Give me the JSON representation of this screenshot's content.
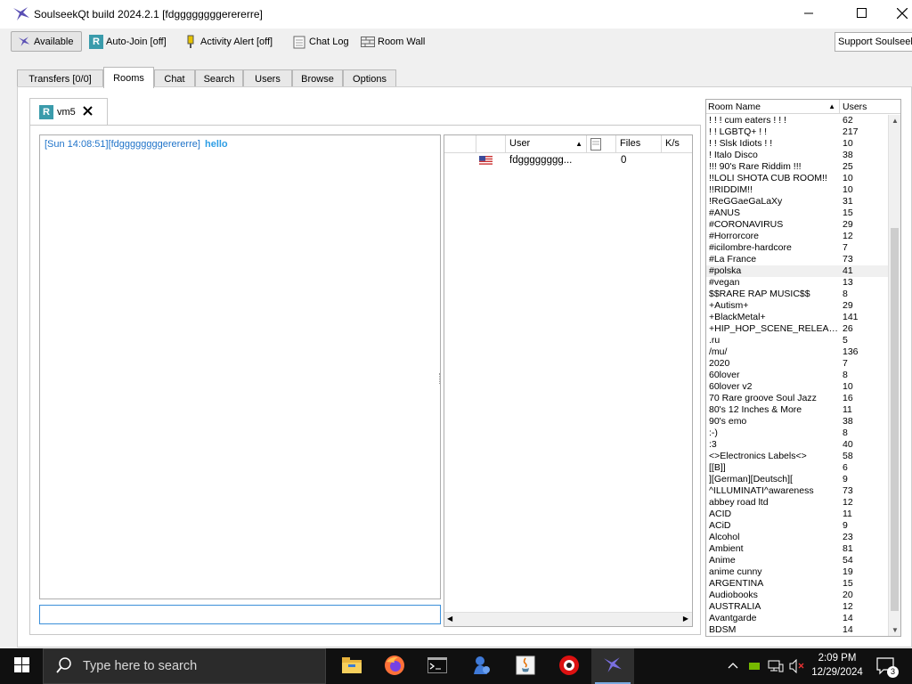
{
  "window": {
    "title": "SoulseekQt build 2024.2.1 [fdggggggggerererre]",
    "minimize_icon": "minimize-icon",
    "maximize_icon": "maximize-icon",
    "close_icon": "close-icon"
  },
  "toolbar": {
    "available": "Available",
    "auto_join": "Auto-Join [off]",
    "activity_alert": "Activity Alert [off]",
    "chat_log": "Chat Log",
    "room_wall": "Room Wall",
    "support": "Support Soulseek"
  },
  "tabs": [
    {
      "label": "Transfers [0/0]"
    },
    {
      "label": "Rooms"
    },
    {
      "label": "Chat"
    },
    {
      "label": "Search"
    },
    {
      "label": "Users"
    },
    {
      "label": "Browse"
    },
    {
      "label": "Options"
    }
  ],
  "room_tab": {
    "badge": "R",
    "name": "vm5"
  },
  "chat": {
    "timestamp": "[Sun 14:08:51]",
    "user": "[fdggggggggerererre]",
    "message": "hello"
  },
  "userlist": {
    "headers": {
      "user": "User",
      "files": "Files",
      "speed": "K/s"
    },
    "rows": [
      {
        "user": "fdgggggggg...",
        "files": "0",
        "flag": "us-flag"
      }
    ]
  },
  "rooms": {
    "headers": {
      "name": "Room Name",
      "users": "Users"
    },
    "selected_index": 13,
    "items": [
      {
        "name": "! ! ! cum eaters ! ! !",
        "users": "62"
      },
      {
        "name": "! ! LGBTQ+ ! !",
        "users": "217"
      },
      {
        "name": "! ! Slsk Idiots ! !",
        "users": "10"
      },
      {
        "name": "! Italo Disco",
        "users": "38"
      },
      {
        "name": "!!! 90's Rare Riddim !!!",
        "users": "25"
      },
      {
        "name": "!!LOLI SHOTA CUB ROOM!!",
        "users": "10"
      },
      {
        "name": "!!RIDDIM!!",
        "users": "10"
      },
      {
        "name": "!ReGGaeGaLaXy",
        "users": "31"
      },
      {
        "name": "#ANUS",
        "users": "15"
      },
      {
        "name": "#CORONAVIRUS",
        "users": "29"
      },
      {
        "name": "#Horrorcore",
        "users": "12"
      },
      {
        "name": "#icilombre-hardcore",
        "users": "7"
      },
      {
        "name": "#La France",
        "users": "73"
      },
      {
        "name": "#polska",
        "users": "41"
      },
      {
        "name": "#vegan",
        "users": "13"
      },
      {
        "name": "$$RARE RAP MUSIC$$",
        "users": "8"
      },
      {
        "name": "+Autism+",
        "users": "29"
      },
      {
        "name": "+BlackMetal+",
        "users": "141"
      },
      {
        "name": "+HIP_HOP_SCENE_RELEASES+",
        "users": "26"
      },
      {
        "name": ".ru",
        "users": "5"
      },
      {
        "name": "/mu/",
        "users": "136"
      },
      {
        "name": "2020",
        "users": "7"
      },
      {
        "name": "60lover",
        "users": "8"
      },
      {
        "name": "60lover v2",
        "users": "10"
      },
      {
        "name": "70 Rare groove Soul Jazz",
        "users": "16"
      },
      {
        "name": "80's 12 Inches & More",
        "users": "11"
      },
      {
        "name": "90's emo",
        "users": "38"
      },
      {
        "name": ":-)",
        "users": "8"
      },
      {
        "name": ":3",
        "users": "40"
      },
      {
        "name": "<>Electronics Labels<>",
        "users": "58"
      },
      {
        "name": "[[B]]",
        "users": "6"
      },
      {
        "name": "][German][Deutsch][",
        "users": "9"
      },
      {
        "name": "^ILLUMINATI^awareness",
        "users": "73"
      },
      {
        "name": "abbey road ltd",
        "users": "12"
      },
      {
        "name": "ACID",
        "users": "11"
      },
      {
        "name": "ACiD",
        "users": "9"
      },
      {
        "name": "Alcohol",
        "users": "23"
      },
      {
        "name": "Ambient",
        "users": "81"
      },
      {
        "name": "Anime",
        "users": "54"
      },
      {
        "name": "anime cunny",
        "users": "19"
      },
      {
        "name": "ARGENTINA",
        "users": "15"
      },
      {
        "name": "Audiobooks",
        "users": "20"
      },
      {
        "name": "AUSTRALIA",
        "users": "12"
      },
      {
        "name": "Avantgarde",
        "users": "14"
      },
      {
        "name": "BDSM",
        "users": "14"
      }
    ]
  },
  "taskbar": {
    "search_placeholder": "Type here to search",
    "time": "2:09 PM",
    "date": "12/29/2024",
    "notification_count": "3",
    "apps": [
      "file-explorer-icon",
      "firefox-icon",
      "terminal-icon",
      "agent-icon",
      "java-icon",
      "recorder-icon",
      "soulseek-icon"
    ]
  }
}
